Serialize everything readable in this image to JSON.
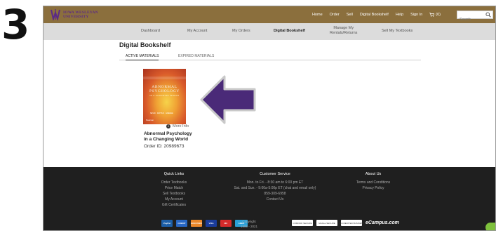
{
  "step_number": "3",
  "brand": {
    "name_line1": "IOWA WESLEYAN",
    "name_line2": "UNIVERSITY",
    "logo_color": "#5b2a86",
    "header_color": "#8b6f3d"
  },
  "top_nav": {
    "items": [
      "Home",
      "Order",
      "Sell",
      "Digital Bookshelf",
      "Help",
      "Sign In"
    ],
    "cart_count": "(0)",
    "search_placeholder": "Search"
  },
  "sub_nav": {
    "items": [
      {
        "label": "Dashboard"
      },
      {
        "label": "My Account"
      },
      {
        "label": "My Orders"
      },
      {
        "label": "Digital Bookshelf",
        "active": true
      },
      {
        "label_line1": "Manage My",
        "label_line2": "Rentals/Returns"
      },
      {
        "label": "Sell My Textbooks"
      }
    ]
  },
  "bookshelf": {
    "title": "Digital Bookshelf",
    "tabs": [
      "ACTIVE MATERIALS",
      "EXPIRED MATERIALS"
    ],
    "active_tab": "ACTIVE MATERIALS"
  },
  "book": {
    "cover_title": "ABNORMAL PSYCHOLOGY",
    "cover_subtitle": "IN A CHANGING WORLD",
    "cover_authors": "NEVID · RATHUS · GREENE",
    "cover_publisher": "Pearson",
    "more_info": "More Info",
    "title_line1": "Abnormal Psychology",
    "title_line2": "in a Changing World",
    "order_id": "Order ID: 20989673"
  },
  "arrow_color": "#4a2a78",
  "footer": {
    "quick_links": {
      "heading": "Quick Links",
      "items": [
        "Order Textbooks",
        "Price Match",
        "Sell Textbooks",
        "My Account",
        "Gift Certificates"
      ]
    },
    "customer_service": {
      "heading": "Customer Service",
      "items": [
        "Mon. to Fri. - 8:30 am to 6:00 pm ET",
        "Sat. and Sun. - 9:00a-5:00p ET (chat and email only)",
        "859-309-6958",
        "Contact Us"
      ]
    },
    "about_us": {
      "heading": "About Us",
      "items": [
        "Terms and Conditions",
        "Privacy Policy"
      ]
    },
    "payments": [
      "PayPal",
      "CREDIT",
      "DISCOVER",
      "VISA",
      "MC",
      "AMEX"
    ],
    "copyright_line1": "Copyright",
    "copyright_line2": "1999 - 2021",
    "badges": [
      "COMODO SECURE",
      "McAfee SECURE",
      "ACCREDITED BUSINESS"
    ],
    "ecampus": "eCampus.com"
  }
}
